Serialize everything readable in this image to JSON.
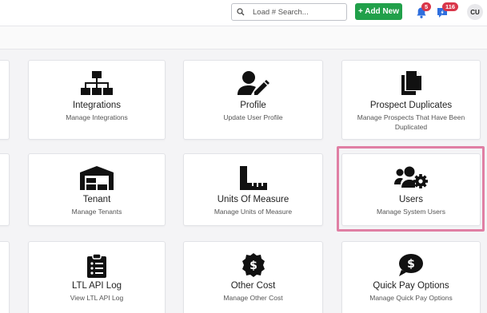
{
  "header": {
    "search_placeholder": "Load # Search...",
    "add_button": "+ Add New",
    "notifications_count": "5",
    "messages_count": "116",
    "avatar_initials": "CU"
  },
  "cards": [
    {
      "title": "Integrations",
      "desc": "Manage Integrations",
      "icon": "sitemap-icon"
    },
    {
      "title": "Profile",
      "desc": "Update User Profile",
      "icon": "user-edit-icon"
    },
    {
      "title": "Prospect Duplicates",
      "desc": "Manage Prospects That Have Been Duplicated",
      "icon": "copy-icon"
    },
    {
      "title": "Tenant",
      "desc": "Manage Tenants",
      "icon": "warehouse-icon"
    },
    {
      "title": "Units Of Measure",
      "desc": "Manage Units of Measure",
      "icon": "ruler-icon"
    },
    {
      "title": "Users",
      "desc": "Manage System Users",
      "icon": "users-cog-icon"
    },
    {
      "title": "LTL API Log",
      "desc": "View LTL API Log",
      "icon": "clipboard-list-icon"
    },
    {
      "title": "Other Cost",
      "desc": "Manage Other Cost",
      "icon": "dollar-badge-icon"
    },
    {
      "title": "Quick Pay Options",
      "desc": "Manage Quick Pay Options",
      "icon": "dollar-comment-icon"
    }
  ],
  "colors": {
    "add_button": "#21a04a",
    "badge": "#d9364a",
    "bell": "#2f6fde",
    "highlight": "#e07fa4"
  }
}
